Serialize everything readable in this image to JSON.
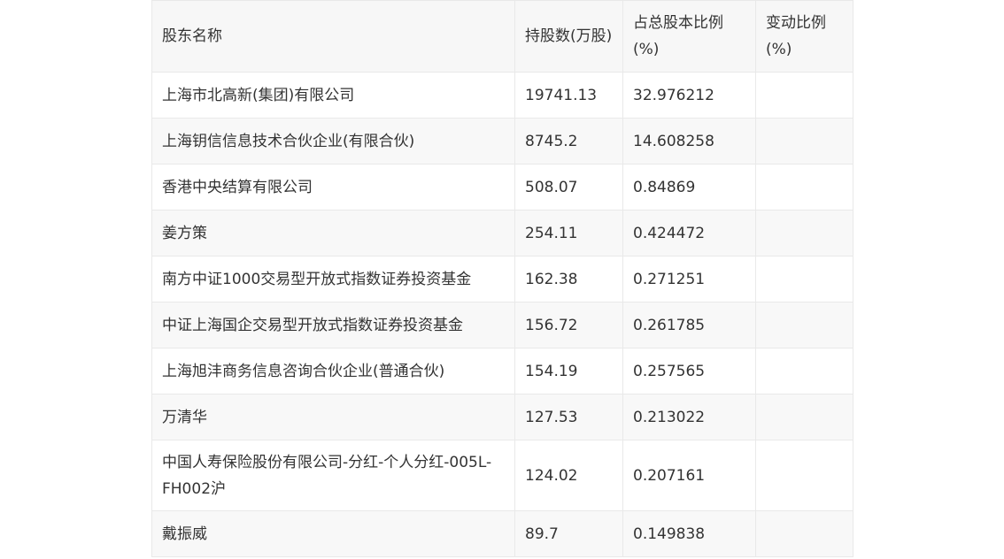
{
  "table": {
    "headers": {
      "name": "股东名称",
      "shares": "持股数(万股)",
      "ratio": "占总股本比例(%)",
      "change": "变动比例(%)"
    },
    "rows": [
      {
        "name": "上海市北高新(集团)有限公司",
        "shares": "19741.13",
        "ratio": "32.976212",
        "change": ""
      },
      {
        "name": "上海钥信信息技术合伙企业(有限合伙)",
        "shares": "8745.2",
        "ratio": "14.608258",
        "change": ""
      },
      {
        "name": "香港中央结算有限公司",
        "shares": "508.07",
        "ratio": "0.84869",
        "change": ""
      },
      {
        "name": "姜方策",
        "shares": "254.11",
        "ratio": "0.424472",
        "change": ""
      },
      {
        "name": "南方中证1000交易型开放式指数证券投资基金",
        "shares": "162.38",
        "ratio": "0.271251",
        "change": ""
      },
      {
        "name": "中证上海国企交易型开放式指数证券投资基金",
        "shares": "156.72",
        "ratio": "0.261785",
        "change": ""
      },
      {
        "name": "上海旭沣商务信息咨询合伙企业(普通合伙)",
        "shares": "154.19",
        "ratio": "0.257565",
        "change": ""
      },
      {
        "name": "万清华",
        "shares": "127.53",
        "ratio": "0.213022",
        "change": ""
      },
      {
        "name": "中国人寿保险股份有限公司-分红-个人分红-005L-FH002沪",
        "shares": "124.02",
        "ratio": "0.207161",
        "change": ""
      },
      {
        "name": "戴振威",
        "shares": "89.7",
        "ratio": "0.149838",
        "change": ""
      }
    ]
  }
}
